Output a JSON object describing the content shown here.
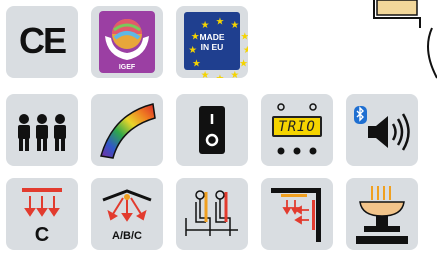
{
  "certifications": {
    "ce": "CE",
    "igef": "IGEF",
    "eu_line1": "MADE",
    "eu_line2": "IN EU"
  },
  "features": {
    "display_text": "TRIO",
    "heater_label": "C",
    "heater_multi_label": "A/B/C"
  },
  "icons": [
    "ce-mark-icon",
    "igef-icon",
    "made-in-eu-icon",
    "three-persons-icon",
    "infrared-spectrum-icon",
    "power-switch-icon",
    "digital-display-icon",
    "bluetooth-speaker-icon",
    "heater-c-icon",
    "heater-abc-icon",
    "seats-icon",
    "corner-heater-icon",
    "sauna-stove-icon"
  ],
  "colors": {
    "tile_bg": "#d9dde1",
    "eu_blue": "#1f3f8f",
    "eu_star": "#f5d400",
    "heat_red": "#e23b2e",
    "accent_orange": "#f0a020",
    "display_yellow": "#f5d400"
  }
}
